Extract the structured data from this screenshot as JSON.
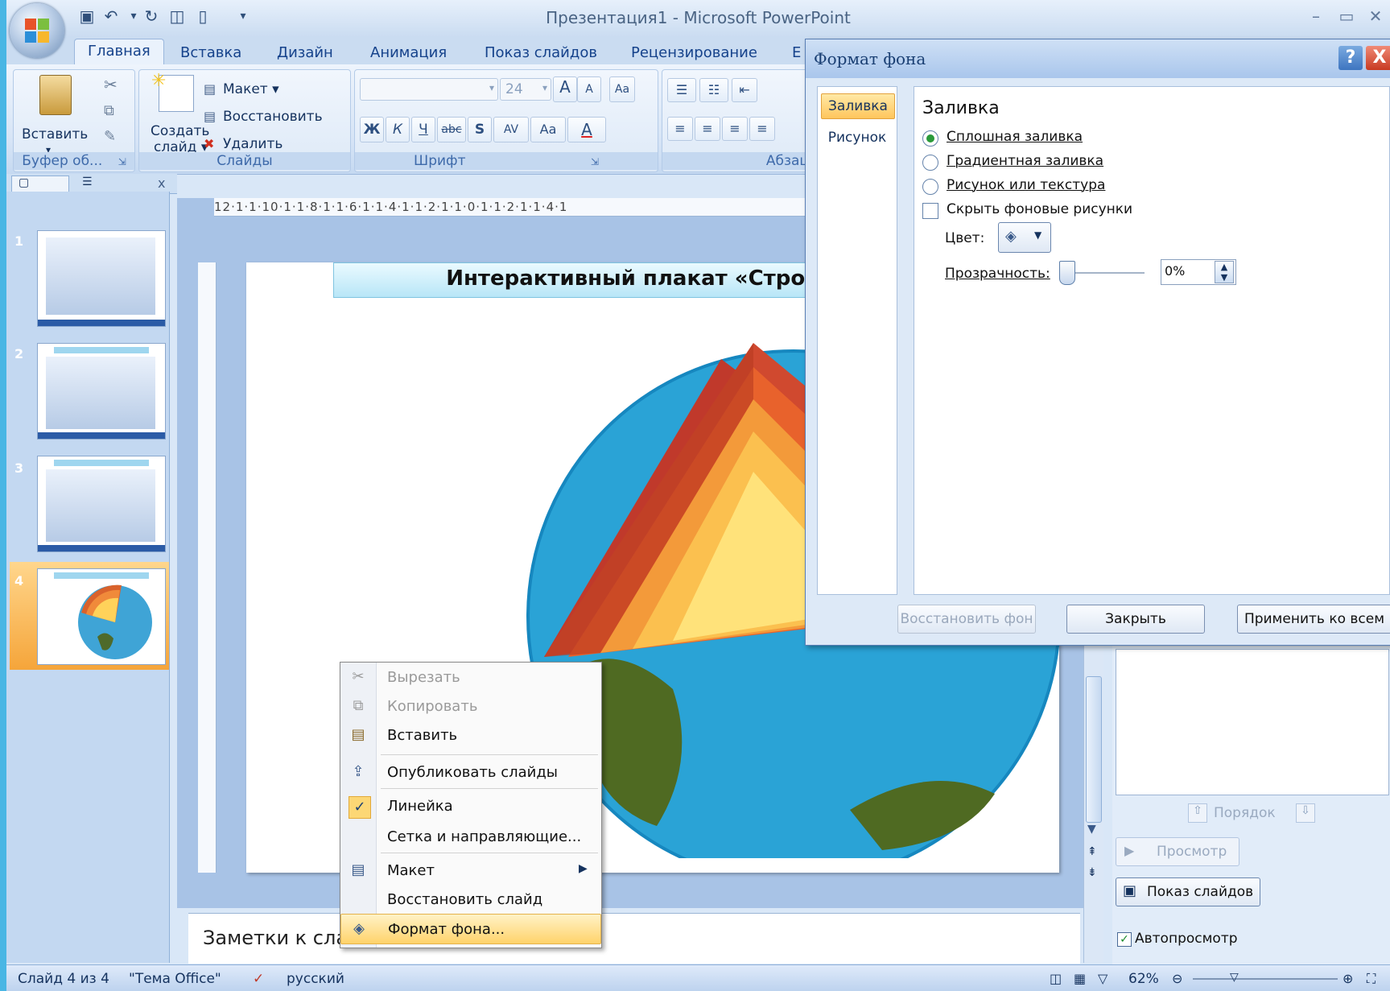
{
  "window": {
    "title": "Презентация1 - Microsoft PowerPoint",
    "min_icon": "minimize-icon",
    "max_icon": "restore-icon",
    "close_icon": "close-icon"
  },
  "ribbon_tabs": [
    "Главная",
    "Вставка",
    "Дизайн",
    "Анимация",
    "Показ слайдов",
    "Рецензирование"
  ],
  "ribbon_tab_partial": "Е",
  "ribbon": {
    "clipboard": {
      "paste_label": "Вставить",
      "group_label": "Буфер об..."
    },
    "slides": {
      "create_label_1": "Создать",
      "create_label_2": "слайд ▾",
      "layout_label": "Макет ▾",
      "restore_label": "Восстановить",
      "delete_label": "Удалить",
      "group_label": "Слайды"
    },
    "font": {
      "font_size": "24",
      "group_label": "Шрифт",
      "bold": "Ж",
      "italic": "К",
      "underline": "Ч",
      "strike": "abc",
      "shadow": "S",
      "spacing": "AV",
      "case": "Aa",
      "grow": "A",
      "shrink": "A"
    },
    "paragraph": {
      "group_label": "Абзац"
    }
  },
  "panel_tabs": {
    "close": "x"
  },
  "slides": [
    {
      "num": "1"
    },
    {
      "num": "2"
    },
    {
      "num": "3"
    },
    {
      "num": "4"
    }
  ],
  "ruler_text": "12·1·1·10·1·1·8·1·1·6·1·1·4·1·1·2·1·1·0·1·1·2·1·1·4·1",
  "slide": {
    "title": "Интерактивный плакат  «Строен"
  },
  "notes": {
    "placeholder": "Заметки к сла"
  },
  "task_pane": {
    "order_label": "Порядок",
    "preview_label": "Просмотр",
    "slideshow_label": "Показ слайдов",
    "autopreview_label": "Автопросмотр"
  },
  "statusbar": {
    "slide_info": "Слайд 4 из 4",
    "theme": "\"Тема Office\"",
    "language": "русский",
    "zoom": "62%"
  },
  "dialog": {
    "title": "Формат фона",
    "help": "?",
    "close": "X",
    "nav": [
      "Заливка",
      "Рисунок"
    ],
    "section_title": "Заливка",
    "options": {
      "solid": "Сплошная заливка",
      "gradient": "Градиентная заливка",
      "picture": "Рисунок или текстура",
      "hide_graphics": "Скрыть фоновые рисунки"
    },
    "color_label": "Цвет:",
    "transparency_label": "Прозрачность:",
    "transparency_value": "0%",
    "buttons": {
      "reset": "Восстановить фон",
      "close": "Закрыть",
      "apply_all": "Применить ко всем"
    }
  },
  "context_menu": [
    {
      "label": "Вырезать",
      "icon": "scissors-icon",
      "disabled": true
    },
    {
      "label": "Копировать",
      "icon": "copy-icon",
      "disabled": true
    },
    {
      "label": "Вставить",
      "icon": "paste-icon",
      "disabled": false
    },
    {
      "label": "Опубликовать слайды",
      "icon": "publish-icon",
      "disabled": false
    },
    {
      "label": "Линейка",
      "icon": "checkmark-icon",
      "disabled": false
    },
    {
      "label": "Сетка и направляющие...",
      "icon": "",
      "disabled": false
    },
    {
      "label": "Макет",
      "icon": "layout-icon",
      "disabled": false
    },
    {
      "label": "Восстановить слайд",
      "icon": "",
      "disabled": false
    },
    {
      "label": "Формат фона...",
      "icon": "format-background-icon",
      "disabled": false
    }
  ]
}
